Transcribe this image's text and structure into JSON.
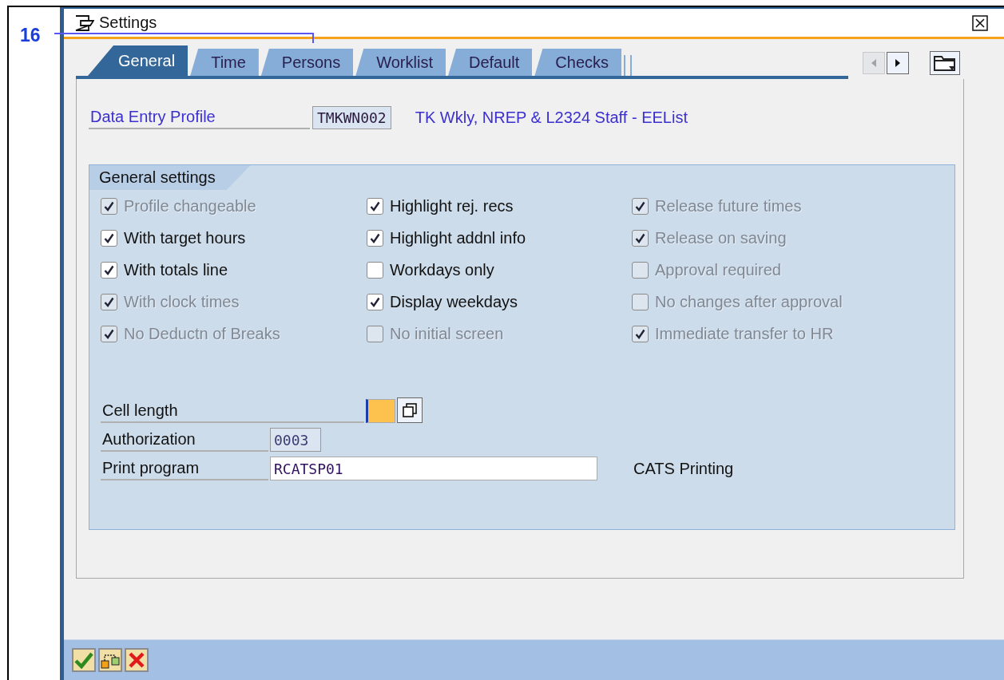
{
  "annotation": {
    "label": "16"
  },
  "window": {
    "title": "Settings"
  },
  "tabs": [
    {
      "label": "General",
      "selected": true
    },
    {
      "label": "Time",
      "selected": false
    },
    {
      "label": "Persons",
      "selected": false
    },
    {
      "label": "Worklist",
      "selected": false
    },
    {
      "label": "Default",
      "selected": false
    },
    {
      "label": "Checks",
      "selected": false
    }
  ],
  "tab_scroll": {
    "back_disabled": true,
    "forward_disabled": false
  },
  "profile": {
    "label": "Data Entry Profile",
    "value": "TMKWN002",
    "description": "TK Wkly, NREP & L2324 Staff - EEList"
  },
  "group": {
    "title": "General settings",
    "columns": [
      [
        {
          "label": "Profile changeable",
          "checked": true,
          "disabled": true
        },
        {
          "label": "With target hours",
          "checked": true,
          "disabled": false
        },
        {
          "label": "With totals line",
          "checked": true,
          "disabled": false
        },
        {
          "label": "With clock times",
          "checked": true,
          "disabled": true
        },
        {
          "label": "No Deductn of Breaks",
          "checked": true,
          "disabled": true
        }
      ],
      [
        {
          "label": "Highlight rej. recs",
          "checked": true,
          "disabled": false
        },
        {
          "label": "Highlight addnl info",
          "checked": true,
          "disabled": false
        },
        {
          "label": "Workdays only",
          "checked": false,
          "disabled": false
        },
        {
          "label": "Display weekdays",
          "checked": true,
          "disabled": false
        },
        {
          "label": "No initial screen",
          "checked": false,
          "disabled": true
        }
      ],
      [
        {
          "label": "Release future times",
          "checked": true,
          "disabled": true
        },
        {
          "label": "Release on saving",
          "checked": true,
          "disabled": true
        },
        {
          "label": "Approval required",
          "checked": false,
          "disabled": true
        },
        {
          "label": "No changes after approval",
          "checked": false,
          "disabled": true
        },
        {
          "label": "Immediate transfer to HR",
          "checked": true,
          "disabled": true
        }
      ]
    ]
  },
  "fields": [
    {
      "label": "Cell length",
      "kind": "required"
    },
    {
      "label": "Authorization",
      "value": "0003",
      "kind": "readonly"
    },
    {
      "label": "Print program",
      "value": "RCATSP01",
      "kind": "input",
      "description": "CATS Printing"
    }
  ],
  "footer_buttons": [
    {
      "kind": "confirm"
    },
    {
      "kind": "hierarchy"
    },
    {
      "kind": "cancel"
    }
  ]
}
